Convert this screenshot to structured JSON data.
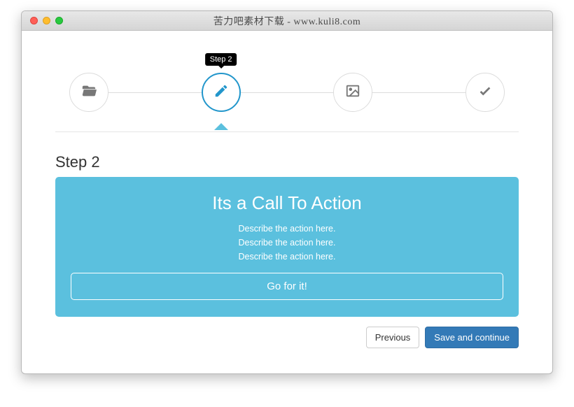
{
  "window": {
    "title": "苦力吧素材下载 - www.kuli8.com"
  },
  "stepper": {
    "tooltip": "Step 2",
    "steps": [
      {
        "icon": "folder-open-icon",
        "active": false
      },
      {
        "icon": "pencil-icon",
        "active": true
      },
      {
        "icon": "image-icon",
        "active": false
      },
      {
        "icon": "check-icon",
        "active": false
      }
    ]
  },
  "panel": {
    "step_title": "Step 2",
    "cta_title": "Its a Call To Action",
    "cta_lines": {
      "0": "Describe the action here.",
      "1": "Describe the action here.",
      "2": "Describe the action here."
    },
    "cta_button": "Go for it!"
  },
  "nav": {
    "previous": "Previous",
    "save": "Save and continue"
  },
  "colors": {
    "accent": "#5bc0de",
    "primary_btn": "#337ab7",
    "step_active": "#2296cb"
  }
}
